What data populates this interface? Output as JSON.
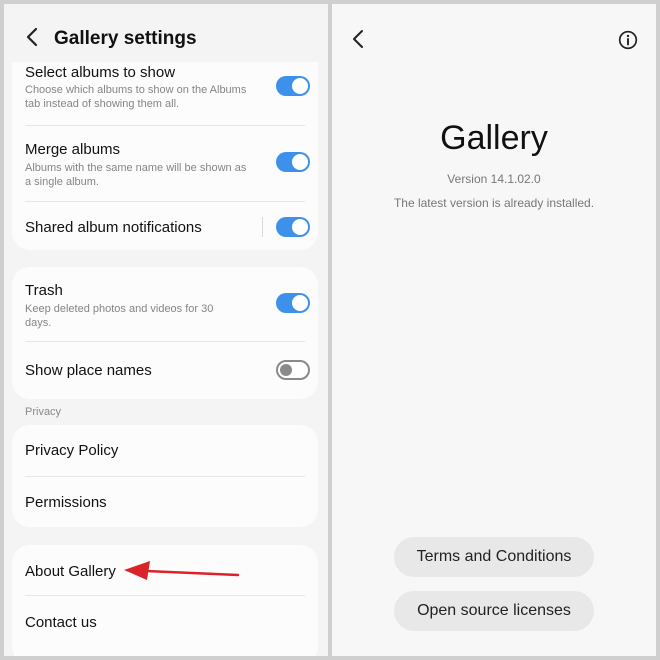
{
  "left": {
    "header": {
      "title": "Gallery settings",
      "back_icon": "chevron-left-icon"
    },
    "group1": [
      {
        "title": "Select albums to show",
        "subtitle": "Choose which albums to show on the Albums tab instead of showing them all.",
        "toggle": "on"
      },
      {
        "title": "Merge albums",
        "subtitle": "Albums with the same name will be shown as a single album.",
        "toggle": "on"
      },
      {
        "title": "Shared album notifications",
        "subtitle": "",
        "toggle": "on"
      }
    ],
    "group2": [
      {
        "title": "Trash",
        "subtitle": "Keep deleted photos and videos for 30 days.",
        "toggle": "on"
      },
      {
        "title": "Show place names",
        "subtitle": "",
        "toggle": "off"
      }
    ],
    "privacy_label": "Privacy",
    "group3": [
      {
        "title": "Privacy Policy"
      },
      {
        "title": "Permissions"
      }
    ],
    "group4": [
      {
        "title": "About Gallery"
      },
      {
        "title": "Contact us"
      }
    ],
    "annotation": {
      "arrow_color": "#d9222a"
    }
  },
  "right": {
    "app_name": "Gallery",
    "version": "Version 14.1.02.0",
    "status": "The latest version is already installed.",
    "terms_button": "Terms and Conditions",
    "licenses_button": "Open source licenses",
    "info_icon": "info-icon",
    "back_icon": "chevron-left-icon"
  },
  "colors": {
    "toggle_on": "#3e91ea",
    "panel_bg": "#f4f4f4",
    "card_bg": "#fcfcfc"
  }
}
